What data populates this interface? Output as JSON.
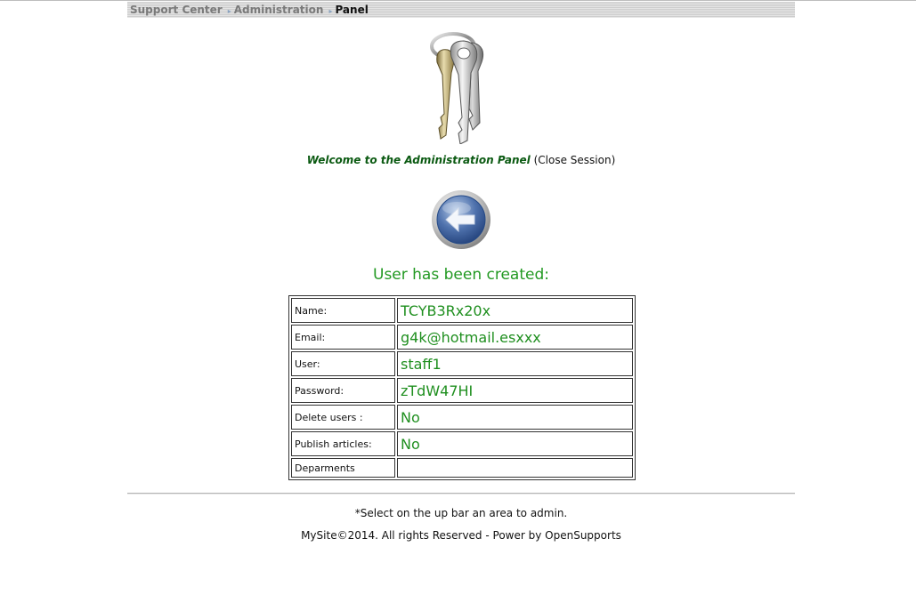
{
  "breadcrumb": {
    "items": [
      "Support Center",
      "Administration"
    ],
    "current": "Panel"
  },
  "welcome": {
    "text": "Welcome to the Administration Panel",
    "close_session": "(Close Session)"
  },
  "status": {
    "message": "User has been created:"
  },
  "user_table": {
    "rows": [
      {
        "label": "Name:",
        "value": "TCYB3Rx20x"
      },
      {
        "label": "Email:",
        "value": "g4k@hotmail.esxxx"
      },
      {
        "label": "User:",
        "value": "staff1"
      },
      {
        "label": "Password:",
        "value": "zTdW47HI"
      },
      {
        "label": "Delete users :",
        "value": "No"
      },
      {
        "label": "Publish articles:",
        "value": "No"
      },
      {
        "label": "Deparments",
        "value": ""
      }
    ]
  },
  "footer": {
    "note": "*Select on the up bar an area to admin.",
    "copyright": "MySite©2014. All rights Reserved - Power by",
    "link": "OpenSupports"
  },
  "colors": {
    "welcome_green": "#0b5a12",
    "value_green": "#1f8f1f",
    "status_green": "#229922"
  },
  "icons": {
    "logo": "keys-icon",
    "back": "back-arrow-icon",
    "separator": "breadcrumb-separator-icon"
  }
}
